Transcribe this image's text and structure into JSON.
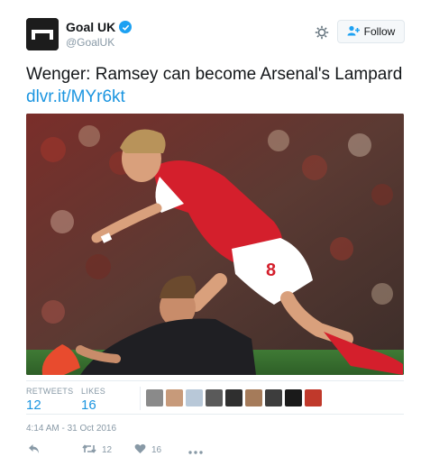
{
  "account": {
    "display_name": "Goal UK",
    "handle": "@GoalUK",
    "verified": true
  },
  "follow_label": "Follow",
  "tweet": {
    "text": "Wenger: Ramsey can become Arsenal's Lampard",
    "link": "dlvr.it/MYr6kt"
  },
  "stats": {
    "retweets_label": "RETWEETS",
    "retweets_count": "12",
    "likes_label": "LIKES",
    "likes_count": "16"
  },
  "timestamp": "4:14 AM - 31 Oct 2016",
  "actions": {
    "retweet_count": "12",
    "like_count": "16"
  },
  "colors": {
    "link": "#1b95e0",
    "muted": "#8899a6",
    "verified": "#1da1f2",
    "arsenal_red": "#d41f2c"
  },
  "icons": [
    "verified-icon",
    "gear-icon",
    "follow-person-icon",
    "reply-icon",
    "retweet-icon",
    "like-icon",
    "more-icon"
  ]
}
